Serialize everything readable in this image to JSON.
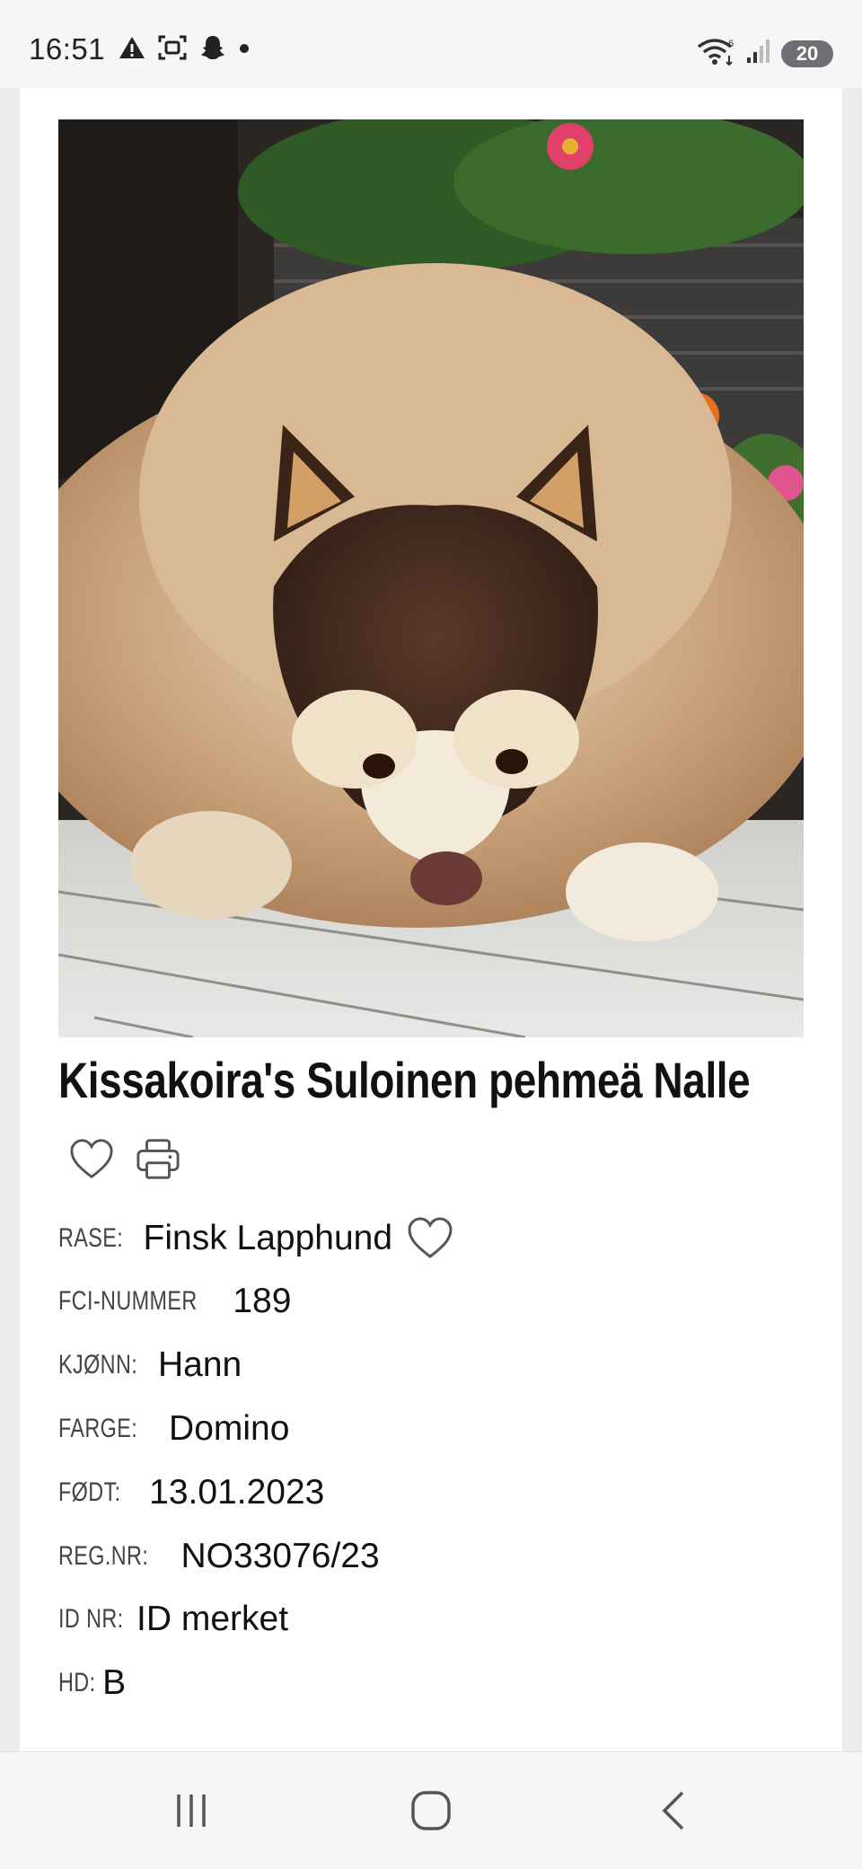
{
  "status_bar": {
    "time": "16:51",
    "battery": "20",
    "left_icons": [
      "warning-icon",
      "screen-capture-icon",
      "snapchat-icon",
      "dot-icon"
    ],
    "right_icons": [
      "wifi-icon",
      "signal-icon",
      "battery-icon"
    ]
  },
  "dog": {
    "name": "Kissakoira's Suloinen pehmeä Nalle",
    "photo_icon": "dog-photo"
  },
  "actions": {
    "favorite_icon": "heart-icon",
    "print_icon": "printer-icon"
  },
  "details": {
    "breed_label": "RASE:",
    "breed_value": "Finsk Lapphund",
    "fci_label": "FCI-NUMMER",
    "fci_value": "189",
    "sex_label": "KJØNN:",
    "sex_value": "Hann",
    "color_label": "FARGE:",
    "color_value": "Domino",
    "born_label": "FØDT:",
    "born_value": "13.01.2023",
    "reg_label": "REG.NR:",
    "reg_value": "NO33076/23",
    "id_label": "ID NR:",
    "id_value": "ID merket",
    "hd_label": "HD:",
    "hd_value": "B"
  },
  "nav_bar": {
    "buttons": [
      "recent-apps-icon",
      "home-icon",
      "back-icon"
    ]
  }
}
